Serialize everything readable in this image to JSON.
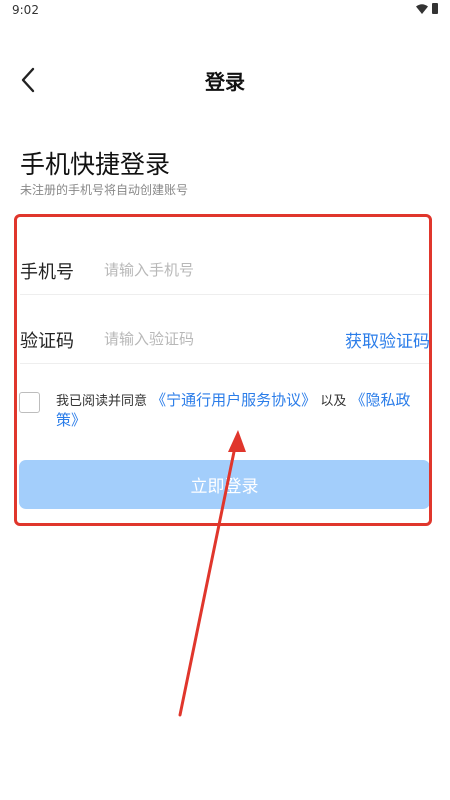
{
  "status_bar": {
    "time": "9:02",
    "icons": [
      "wifi-icon",
      "battery-icon"
    ]
  },
  "app_bar": {
    "title": "登录",
    "back_icon": "chevron-left-icon"
  },
  "heading": {
    "title": "手机快捷登录",
    "subtitle": "未注册的手机号将自动创建账号"
  },
  "form": {
    "phone": {
      "label": "手机号",
      "placeholder": "请输入手机号",
      "value": ""
    },
    "code": {
      "label": "验证码",
      "placeholder": "请输入验证码",
      "value": "",
      "get_code_label": "获取验证码"
    },
    "agreement": {
      "checked": false,
      "prefix": "我已阅读并同意",
      "service_link": "《宁通行用户服务协议》",
      "joiner": "以及",
      "privacy_link": "《隐私政策》"
    },
    "submit_label": "立即登录"
  },
  "colors": {
    "accent": "#2b7de9",
    "button_disabled": "#a3cefb",
    "annotation": "#e0362c"
  }
}
